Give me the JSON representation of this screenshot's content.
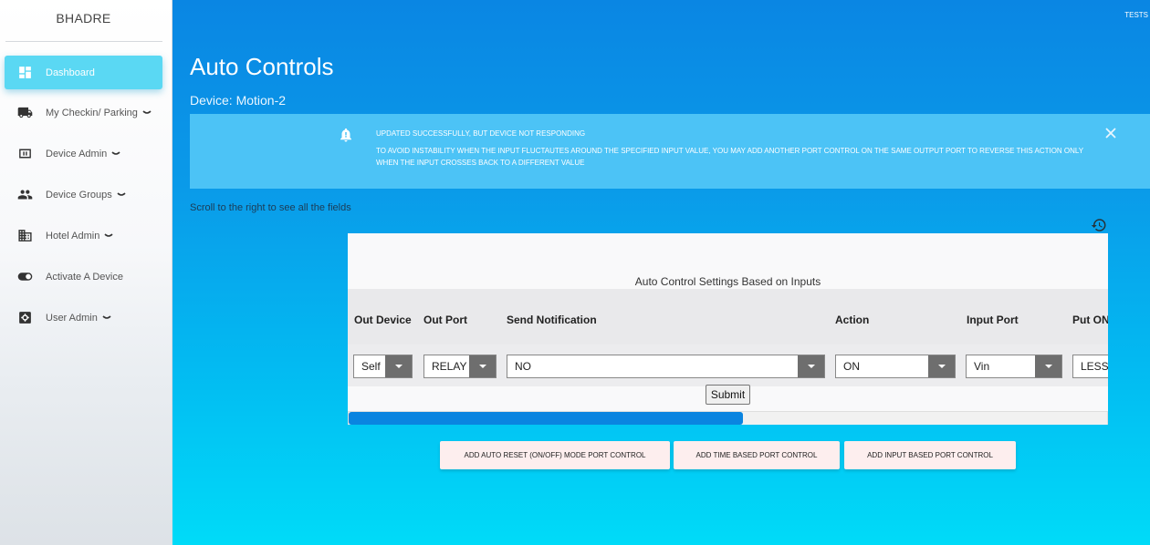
{
  "sidebar": {
    "brand": "BHADRE",
    "items": [
      {
        "label": "Dashboard",
        "icon": "dashboard-icon",
        "active": true
      },
      {
        "label": "My Checkin/ Parking",
        "icon": "truck-icon",
        "expandable": true
      },
      {
        "label": "Device Admin",
        "icon": "device-icon",
        "expandable": true
      },
      {
        "label": "Device Groups",
        "icon": "people-icon",
        "expandable": true
      },
      {
        "label": "Hotel Admin",
        "icon": "building-icon",
        "expandable": true
      },
      {
        "label": "Activate A Device",
        "icon": "toggle-icon",
        "expandable": false
      },
      {
        "label": "User Admin",
        "icon": "settings-icon",
        "expandable": true
      }
    ]
  },
  "header": {
    "user": "TESTS",
    "title": "Auto Controls",
    "device_label": "Device: Motion-2"
  },
  "alert": {
    "icon": "bell-alert-icon",
    "line1": "Updated Successfully, but device not responding",
    "line2": "To avoid instability when the input fluctautes around the specified input value, you may add another port control on the same output port to reverse this action only when the input crosses back to a different value"
  },
  "scroll_hint": "Scroll to the right to see all the fields",
  "table": {
    "caption": "Auto Control Settings Based on Inputs",
    "columns": [
      "Out Device",
      "Out Port",
      "Send Notification",
      "Action",
      "Input Port",
      "Put ON/"
    ],
    "row": {
      "out_device": "Self",
      "out_port": "RELAY",
      "send_notification": "NO",
      "action": "ON",
      "input_port": "Vin",
      "put_on": "LESS"
    },
    "submit_label": "Submit",
    "scroll_fraction": 0.52
  },
  "buttons": {
    "auto_reset": "Add Auto Reset (ON/OFF) Mode Port Control",
    "time_based": "Add Time Based Port Control",
    "input_based": "Add Input Based Port Control"
  },
  "colors": {
    "accent": "#5ad8f3",
    "main_top": "#0a86e3",
    "main_bottom": "#00dbf8",
    "alert_bg": "#4cc3f6"
  }
}
